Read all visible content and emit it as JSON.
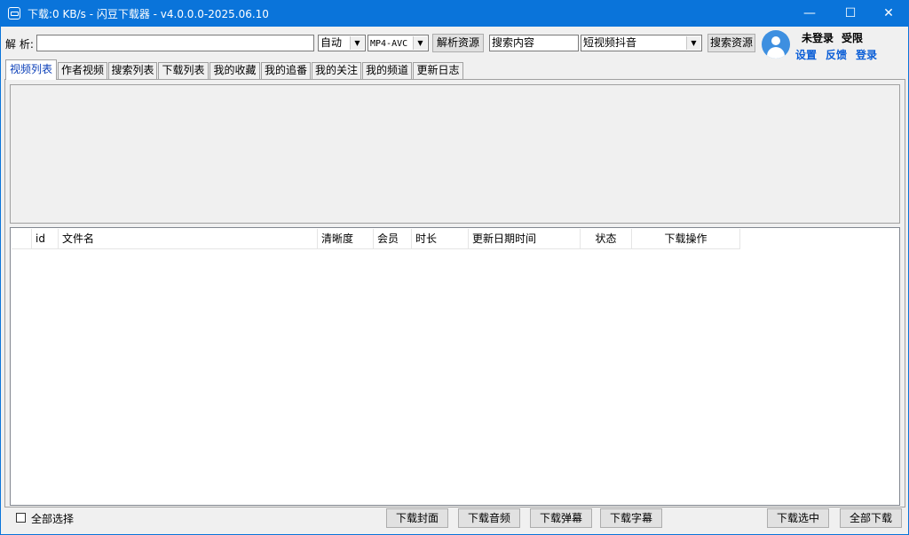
{
  "window": {
    "title": "下载:0 KB/s - 闪豆下载器 - v4.0.0.0-2025.06.10",
    "minimize": "—",
    "maximize": "☐",
    "close": "✕",
    "accent": "#0a74da"
  },
  "toolbar": {
    "parse_label": "解 析:",
    "parse_value": "",
    "quality_select": "自动",
    "format_select": "MP4-AVC",
    "parse_button": "解析资源",
    "search_input": "搜索内容",
    "platform_select": "短视频抖音",
    "search_button": "搜索资源"
  },
  "user": {
    "status": "未登录",
    "limit": "受限",
    "settings": "设置",
    "feedback": "反馈",
    "login": "登录"
  },
  "tabs": [
    "视频列表",
    "作者视频",
    "搜索列表",
    "下载列表",
    "我的收藏",
    "我的追番",
    "我的关注",
    "我的频道",
    "更新日志"
  ],
  "table": {
    "columns": [
      "",
      "id",
      "文件名",
      "清晰度",
      "会员",
      "时长",
      "更新日期时间",
      "状态",
      "下载操作"
    ],
    "rows": []
  },
  "footer": {
    "select_all": "全部选择",
    "download_cover": "下载封面",
    "download_audio": "下载音频",
    "download_danmaku": "下载弹幕",
    "download_subtitle": "下载字幕",
    "download_selected": "下载选中",
    "download_all": "全部下载"
  }
}
